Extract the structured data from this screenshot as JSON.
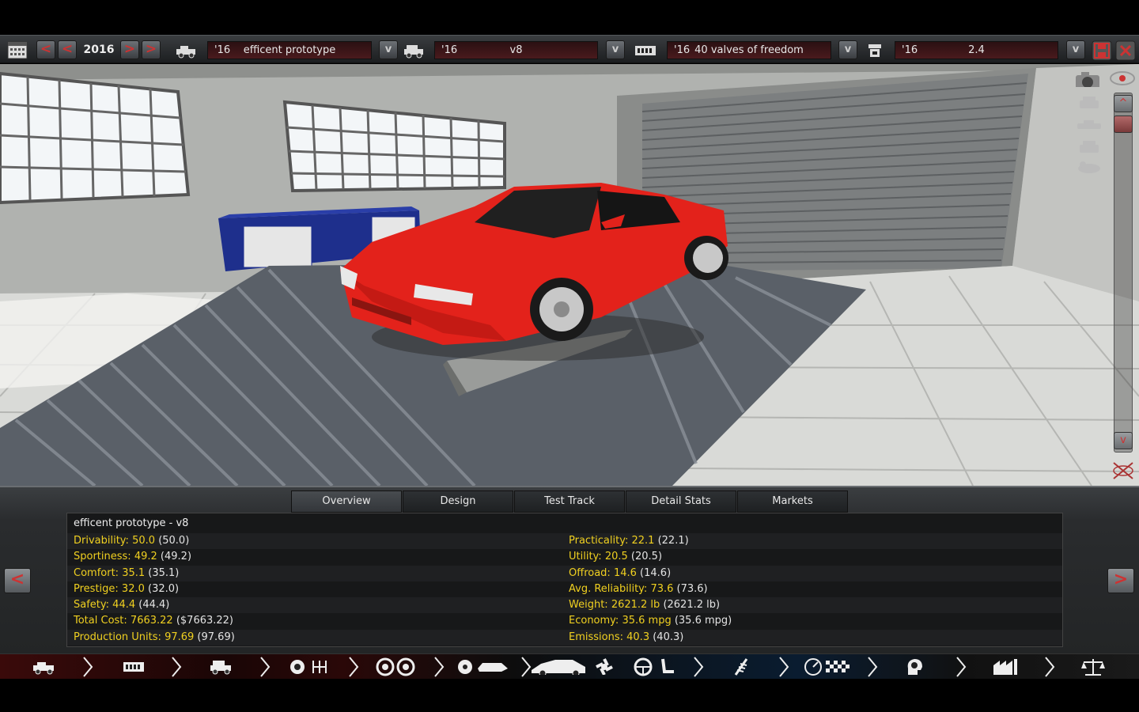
{
  "topbar": {
    "year": "2016",
    "prev_fast": "<",
    "prev": "<",
    "next": ">",
    "next_fast": ">",
    "dropdown_glyph": "v",
    "selectors": [
      {
        "year": "'16",
        "name": "efficent prototype",
        "icon": "car-chassis-icon"
      },
      {
        "year": "'16",
        "name": "v8",
        "icon": "car-model-icon"
      },
      {
        "year": "'16",
        "name": "40 valves of freedom",
        "icon": "engine-icon"
      },
      {
        "year": "'16",
        "name": "2.4",
        "icon": "engine-variant-icon"
      }
    ]
  },
  "sidebar": {
    "up": "^",
    "down": "v"
  },
  "tabs": [
    "Overview",
    "Design",
    "Test Track",
    "Detail Stats",
    "Markets"
  ],
  "active_tab": "Overview",
  "panel": {
    "prev": "<",
    "next": ">",
    "title": "efficent prototype - v8",
    "left_stats": [
      {
        "label": "Drivability:",
        "value": "50.0",
        "ref": "(50.0)"
      },
      {
        "label": "Sportiness:",
        "value": "49.2",
        "ref": "(49.2)"
      },
      {
        "label": "Comfort:",
        "value": "35.1",
        "ref": "(35.1)"
      },
      {
        "label": "Prestige:",
        "value": "32.0",
        "ref": "(32.0)"
      },
      {
        "label": "Safety:",
        "value": "44.4",
        "ref": "(44.4)"
      },
      {
        "label": "Total Cost:",
        "value": "7663.22",
        "ref": "($7663.22)"
      },
      {
        "label": "Production Units:",
        "value": "97.69",
        "ref": "(97.69)"
      }
    ],
    "right_stats": [
      {
        "label": "Practicality:",
        "value": "22.1",
        "ref": "(22.1)"
      },
      {
        "label": "Utility:",
        "value": "20.5",
        "ref": "(20.5)"
      },
      {
        "label": "Offroad:",
        "value": "14.6",
        "ref": "(14.6)"
      },
      {
        "label": "Avg. Reliability:",
        "value": "73.6",
        "ref": "(73.6)"
      },
      {
        "label": "Weight:",
        "value": "2621.2 lb",
        "ref": "(2621.2 lb)"
      },
      {
        "label": "Economy:",
        "value": "35.6 mpg",
        "ref": "(35.6 mpg)"
      },
      {
        "label": "Emissions:",
        "value": "40.3",
        "ref": "(40.3)"
      }
    ]
  },
  "colors": {
    "accent_red": "#cc3333",
    "stat_yellow": "#f0d020",
    "car_red": "#e3221b"
  }
}
